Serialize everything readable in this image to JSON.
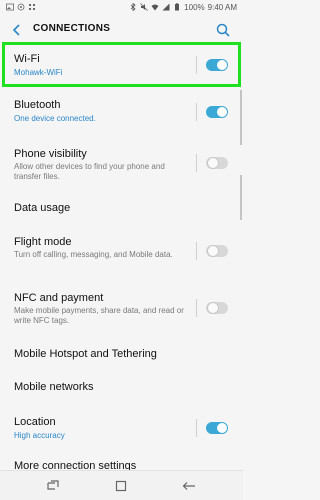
{
  "status_bar": {
    "battery": "100%",
    "time": "9:40 AM",
    "left_icons": [
      "image-icon",
      "settings-notif-icon",
      "grid-icon"
    ],
    "right_icons": [
      "bluetooth-icon",
      "mute-icon",
      "wifi-icon",
      "signal-icon",
      "battery-icon"
    ]
  },
  "header": {
    "title": "CONNECTIONS",
    "back_icon": "back-arrow-icon",
    "search_icon": "search-icon"
  },
  "items": [
    {
      "title": "Wi-Fi",
      "subtitle": "Mohawk-WiFi",
      "subtitle_style": "blue",
      "toggle": "on",
      "highlighted": true
    },
    {
      "title": "Bluetooth",
      "subtitle": "One device connected.",
      "subtitle_style": "blue",
      "toggle": "on"
    },
    {
      "title": "Phone visibility",
      "subtitle": "Allow other devices to find your phone and transfer files.",
      "subtitle_style": "gray",
      "toggle": "off"
    },
    {
      "title": "Data usage"
    },
    {
      "title": "Flight mode",
      "subtitle": "Turn off calling, messaging, and Mobile data.",
      "subtitle_style": "gray",
      "toggle": "off"
    },
    {
      "title": "NFC and payment",
      "subtitle": "Make mobile payments, share data, and read or write NFC tags.",
      "subtitle_style": "gray",
      "toggle": "off"
    },
    {
      "title": "Mobile Hotspot and Tethering"
    },
    {
      "title": "Mobile networks"
    },
    {
      "title": "Location",
      "subtitle": "High accuracy",
      "subtitle_style": "blue",
      "toggle": "on"
    },
    {
      "title": "More connection settings"
    }
  ],
  "colors": {
    "accent": "#3ca8d6",
    "subtitle_blue": "#2a87c8",
    "highlight": "#1fe01f",
    "background": "#f5f5f5"
  },
  "navbar": {
    "icons": [
      "recents-icon",
      "home-icon",
      "back-icon"
    ]
  }
}
